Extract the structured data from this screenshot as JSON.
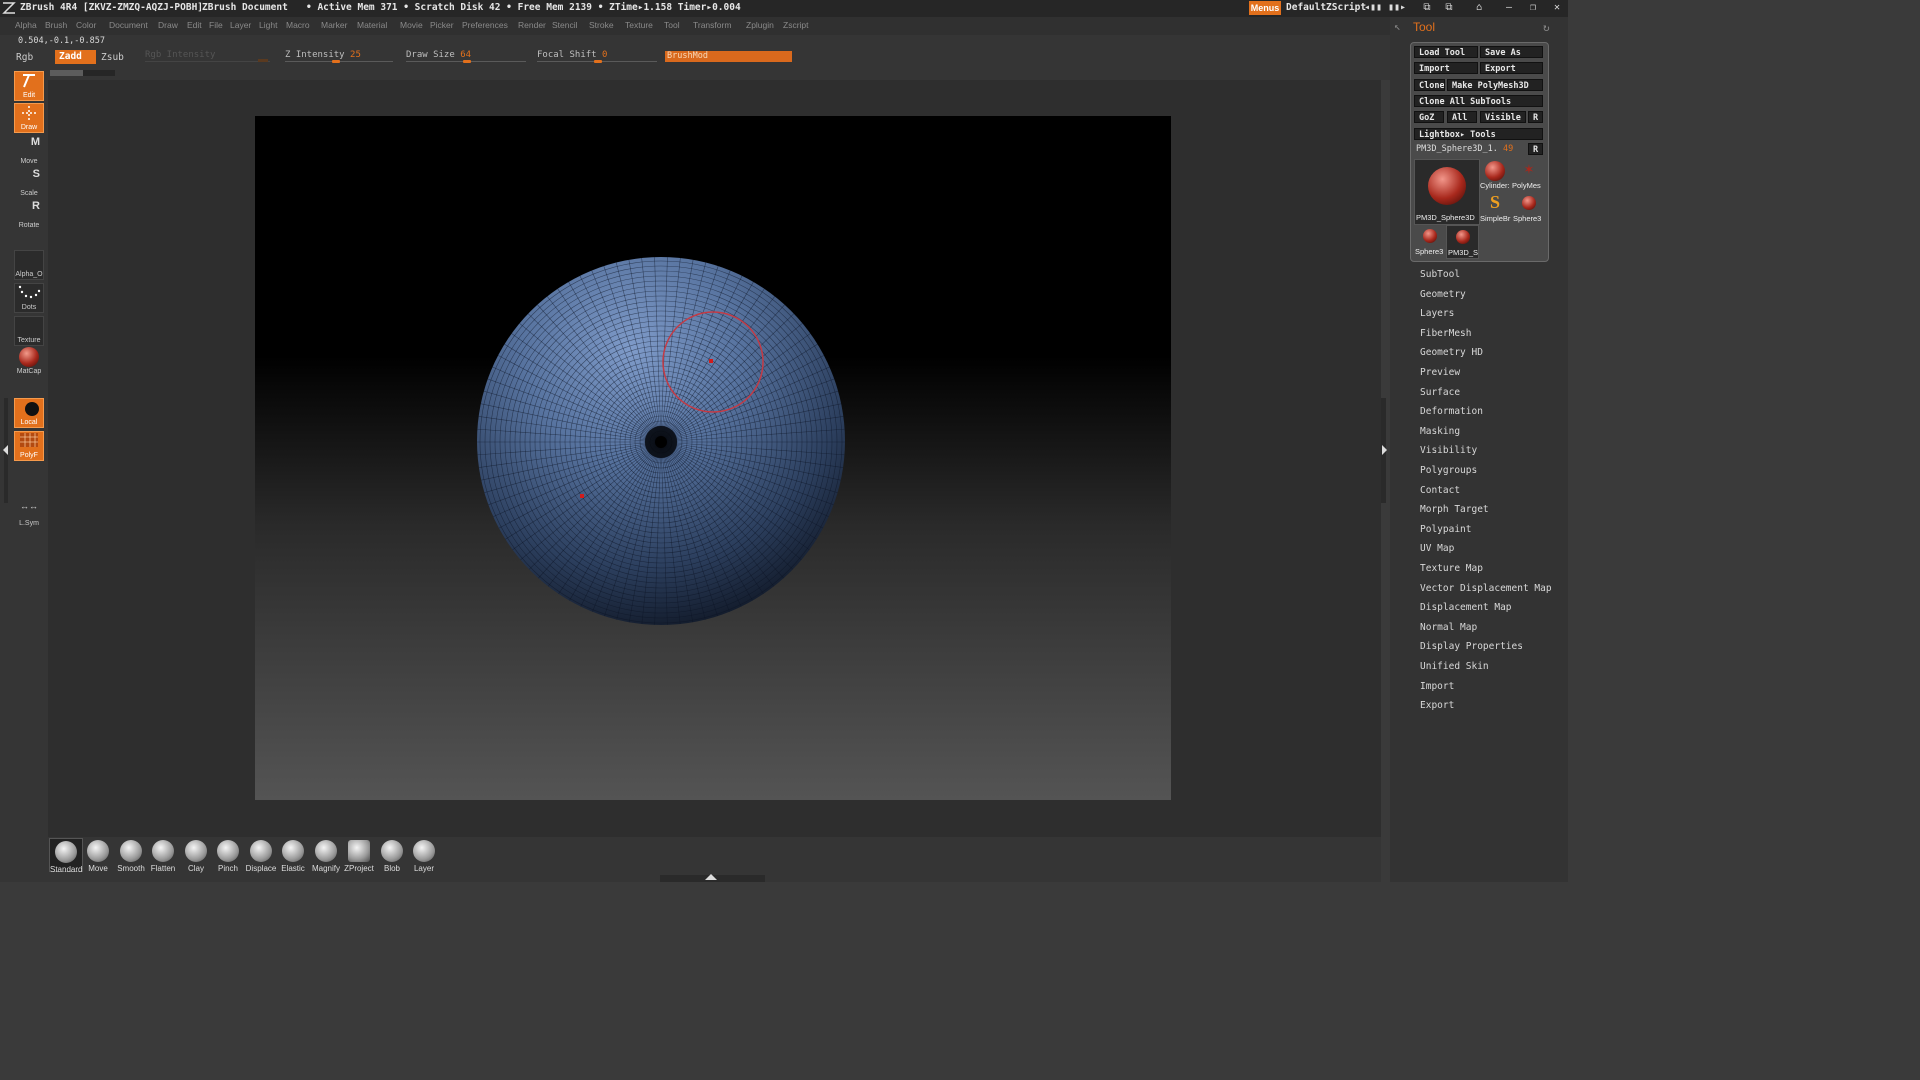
{
  "titlebar": {
    "app": "ZBrush 4R4 [ZKVZ-ZMZQ-AQZJ-POBH]",
    "document": "ZBrush Document",
    "stats": "• Active Mem 371 • Scratch Disk 42 • Free Mem 2139 • ZTime▸1.158 Timer▸0.004",
    "menus": "Menus",
    "script": "DefaultZScript"
  },
  "menubar": [
    "Alpha",
    "Brush",
    "Color",
    "Document",
    "Draw",
    "Edit",
    "File",
    "Layer",
    "Light",
    "Macro",
    "Marker",
    "Material",
    "Movie",
    "Picker",
    "Preferences",
    "Render",
    "Stencil",
    "Stroke",
    "Texture",
    "Tool",
    "Transform",
    "Zplugin",
    "Zscript"
  ],
  "toolbar": {
    "coords": "0.504,-0.1,-0.857",
    "rgb": "Rgb",
    "zadd": "Zadd",
    "zsub": "Zsub",
    "rgb_intensity": "Rgb Intensity",
    "z_intensity_label": "Z Intensity",
    "z_intensity": "25",
    "draw_size_label": "Draw Size",
    "draw_size": "64",
    "focal_shift_label": "Focal Shift",
    "focal_shift": "0",
    "brushmod": "BrushMod"
  },
  "leftshelf": {
    "edit": "Edit",
    "draw": "Draw",
    "move": "Move",
    "scale": "Scale",
    "rotate": "Rotate",
    "alpha": "Alpha_O",
    "dots": "Dots",
    "texture": "Texture",
    "matcap": "MatCap",
    "local": "Local",
    "polyf": "PolyF",
    "lsym": "L.Sym"
  },
  "tool": {
    "title": "Tool",
    "load_tool": "Load Tool",
    "save_as": "Save As",
    "import": "Import",
    "export": "Export",
    "clone": "Clone",
    "make_polymesh": "Make PolyMesh3D",
    "clone_all": "Clone All SubTools",
    "goz": "GoZ",
    "all": "All",
    "visible": "Visible",
    "r": "R",
    "lightbox": "Lightbox▸ Tools",
    "current_tool": "PM3D_Sphere3D_1.",
    "current_tool_num": "49",
    "thumbs": [
      "PM3D_Sphere3D",
      "Cylinder:",
      "PolyMes",
      "SimpleBr",
      "Sphere3",
      "Sphere3",
      "PM3D_S"
    ]
  },
  "tool_menu": [
    "SubTool",
    "Geometry",
    "Layers",
    "FiberMesh",
    "Geometry HD",
    "Preview",
    "Surface",
    "Deformation",
    "Masking",
    "Visibility",
    "Polygroups",
    "Contact",
    "Morph Target",
    "Polypaint",
    "UV Map",
    "Texture Map",
    "Vector Displacement Map",
    "Displacement Map",
    "Normal Map",
    "Display Properties",
    "Unified Skin",
    "Import",
    "Export"
  ],
  "brushes": [
    "Standard",
    "Move",
    "Smooth",
    "Flatten",
    "Clay",
    "Pinch",
    "Displace",
    "Elastic",
    "Magnify",
    "ZProject",
    "Blob",
    "Layer"
  ],
  "colors": {
    "accent": "#e2701c",
    "sphere": "#4d6a96"
  }
}
